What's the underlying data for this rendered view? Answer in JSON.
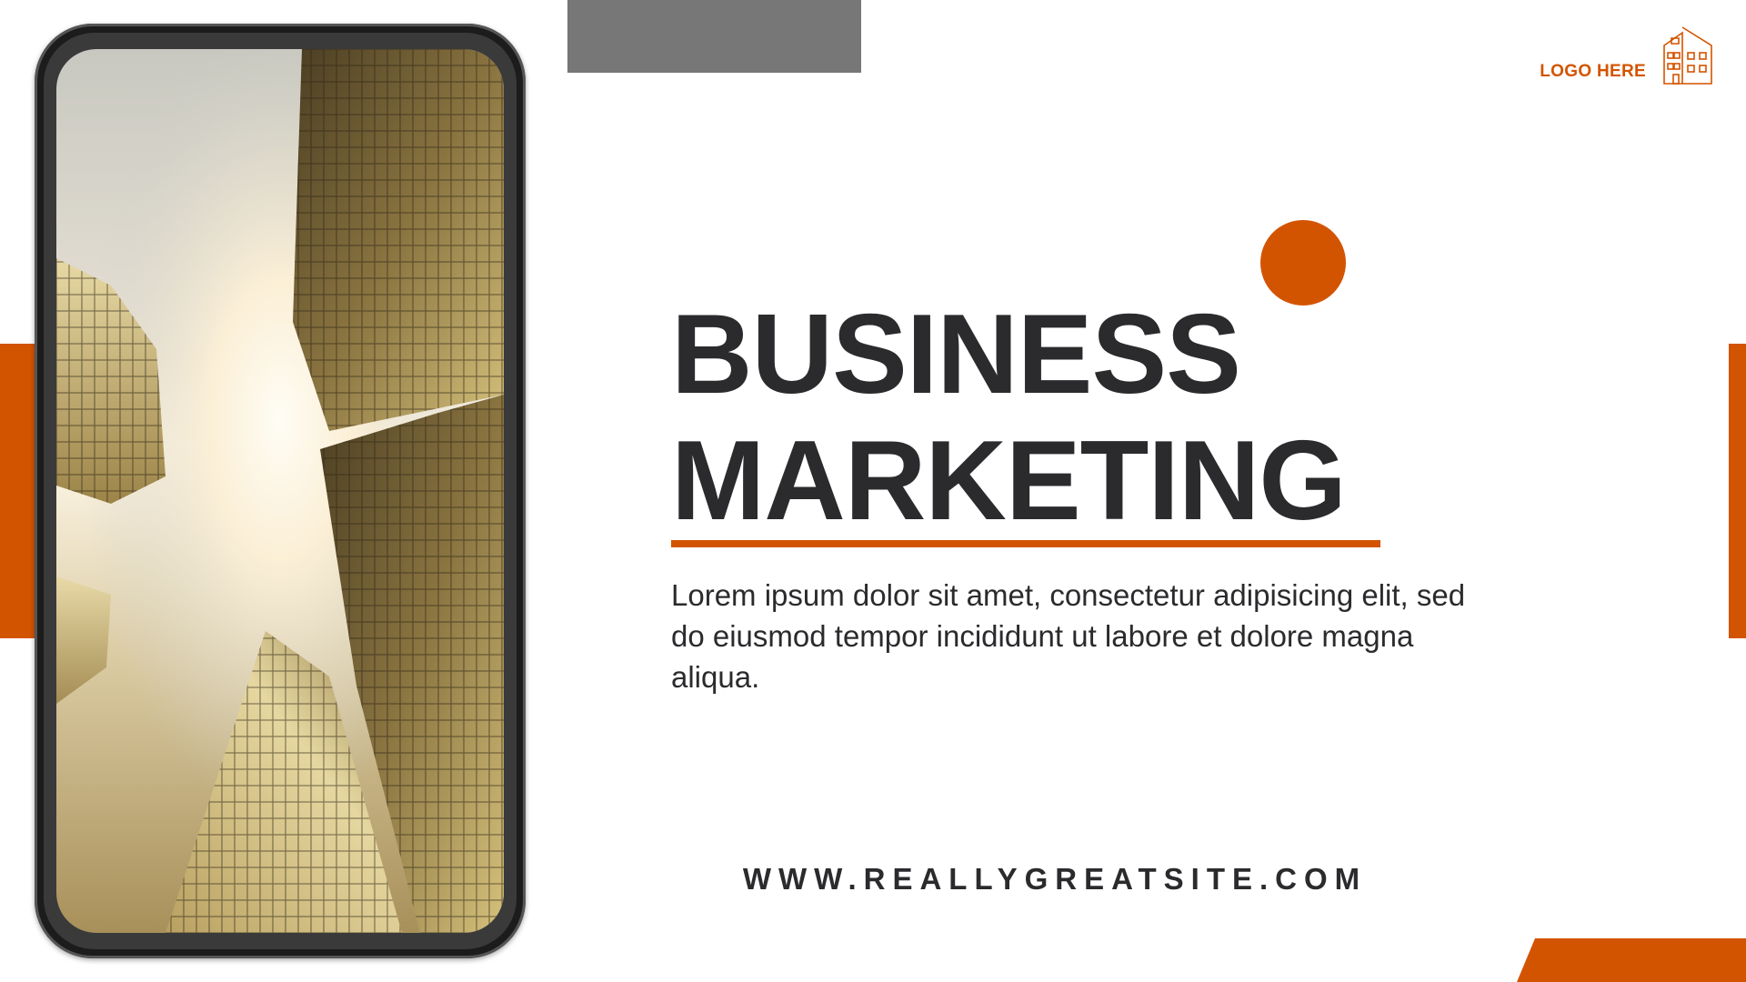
{
  "colors": {
    "accent": "#D35400",
    "dark_text": "#2B2B2E",
    "gray_block": "#777777",
    "background": "#FFFFFF"
  },
  "logo": {
    "text": "LOGO HERE",
    "icon": "building-icon"
  },
  "headline": {
    "line1": "BUSINESS",
    "line2": "MARKETING"
  },
  "body": {
    "text": "Lorem ipsum dolor sit amet, consectetur adipisicing elit, sed do eiusmod tempor incididunt ut labore et dolore magna aliqua."
  },
  "website": "WWW.REALLYGREATSITE.COM",
  "phone_image": {
    "icon": "city-skyscrapers-image"
  }
}
